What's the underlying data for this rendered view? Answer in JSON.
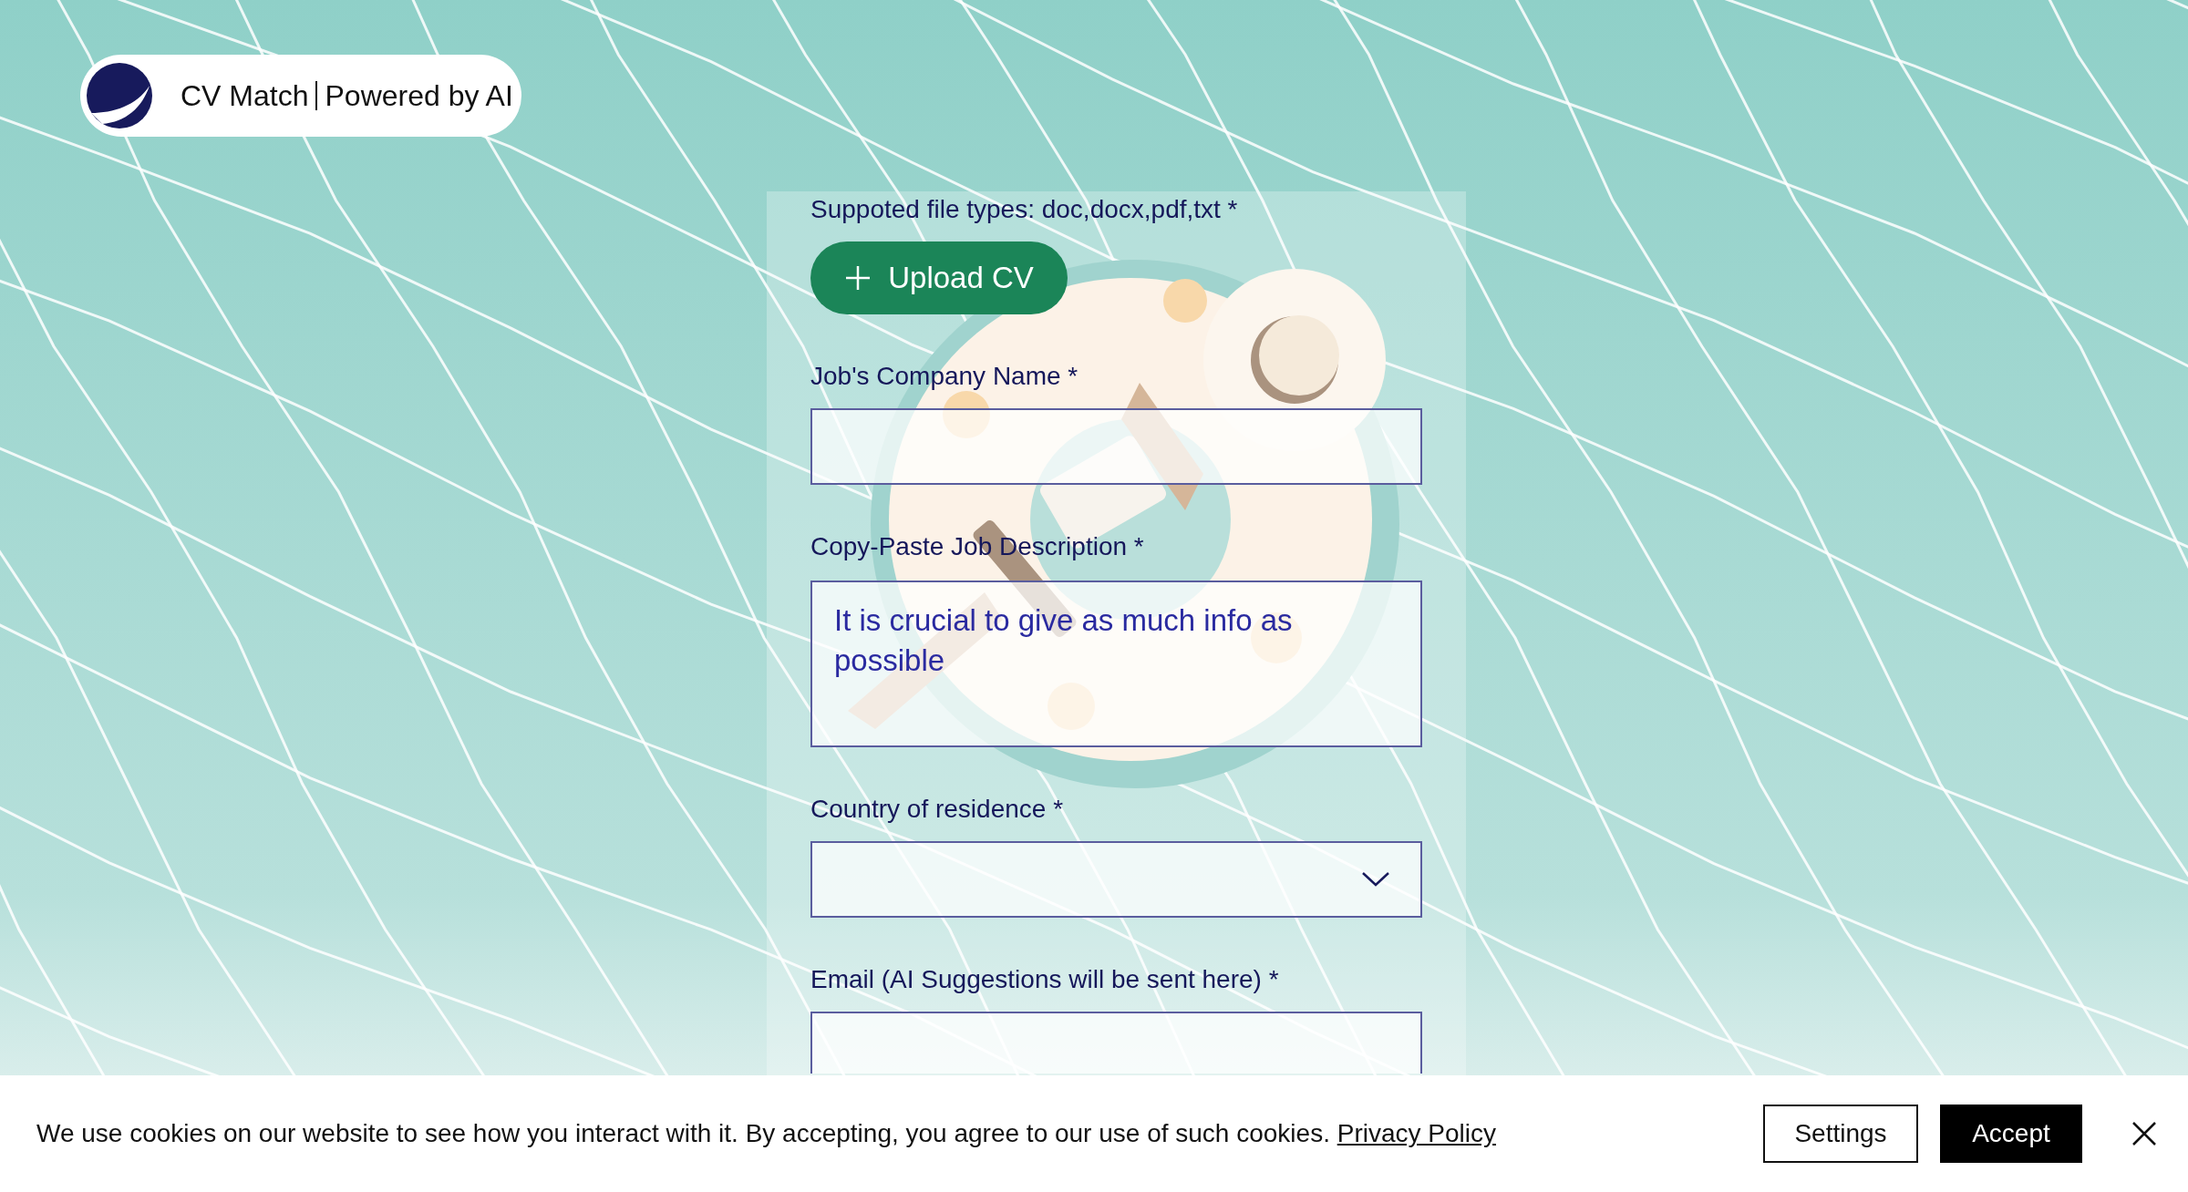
{
  "header": {
    "title": "CV Match",
    "subtitle": "Powered by AI"
  },
  "form": {
    "upload": {
      "label": "Suppoted file types: doc,docx,pdf,txt *",
      "button": "Upload CV"
    },
    "fields": [
      {
        "kind": "text",
        "label": "Job's Company Name *"
      },
      {
        "kind": "textarea",
        "label": "Copy-Paste Job Description *",
        "placeholder": "It is crucial to give as much info as possible"
      },
      {
        "kind": "select",
        "label": "Country of residence *"
      },
      {
        "kind": "text",
        "label": "Email (AI Suggestions will be sent here) *"
      }
    ]
  },
  "cookie_banner": {
    "text": "We use cookies on our website to see how you interact with it. By accepting, you agree to our use of such cookies.",
    "link": "Privacy Policy",
    "buttons": [
      {
        "label": "Settings",
        "kind": "secondary"
      },
      {
        "label": "Accept",
        "kind": "primary"
      }
    ]
  }
}
